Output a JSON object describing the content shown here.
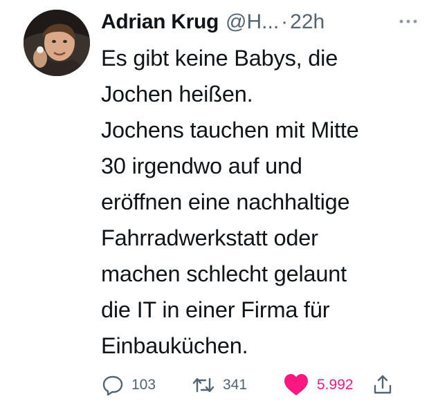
{
  "tweet": {
    "author_name": "Adrian Krug",
    "author_handle": "@H...",
    "separator": "·",
    "timestamp": "22h",
    "text_lines": [
      "Es gibt keine Babys, die",
      "Jochen heißen.",
      "Jochens tauchen mit Mitte",
      "30 irgendwo auf und",
      "eröffnen eine nachhaltige",
      "Fahrradwerkstatt oder",
      "machen schlecht gelaunt",
      "die IT in einer Firma für",
      "Einbauküchen."
    ],
    "replies": "103",
    "retweets": "341",
    "likes": "5.992",
    "liked": true
  },
  "icons": {
    "more": "more-horizontal-icon",
    "reply": "speech-bubble-icon",
    "retweet": "retweet-arrows-icon",
    "like": "heart-filled-icon",
    "share": "share-upload-icon"
  },
  "colors": {
    "text": "#0f1419",
    "secondary": "#536471",
    "like": "#f91880"
  }
}
